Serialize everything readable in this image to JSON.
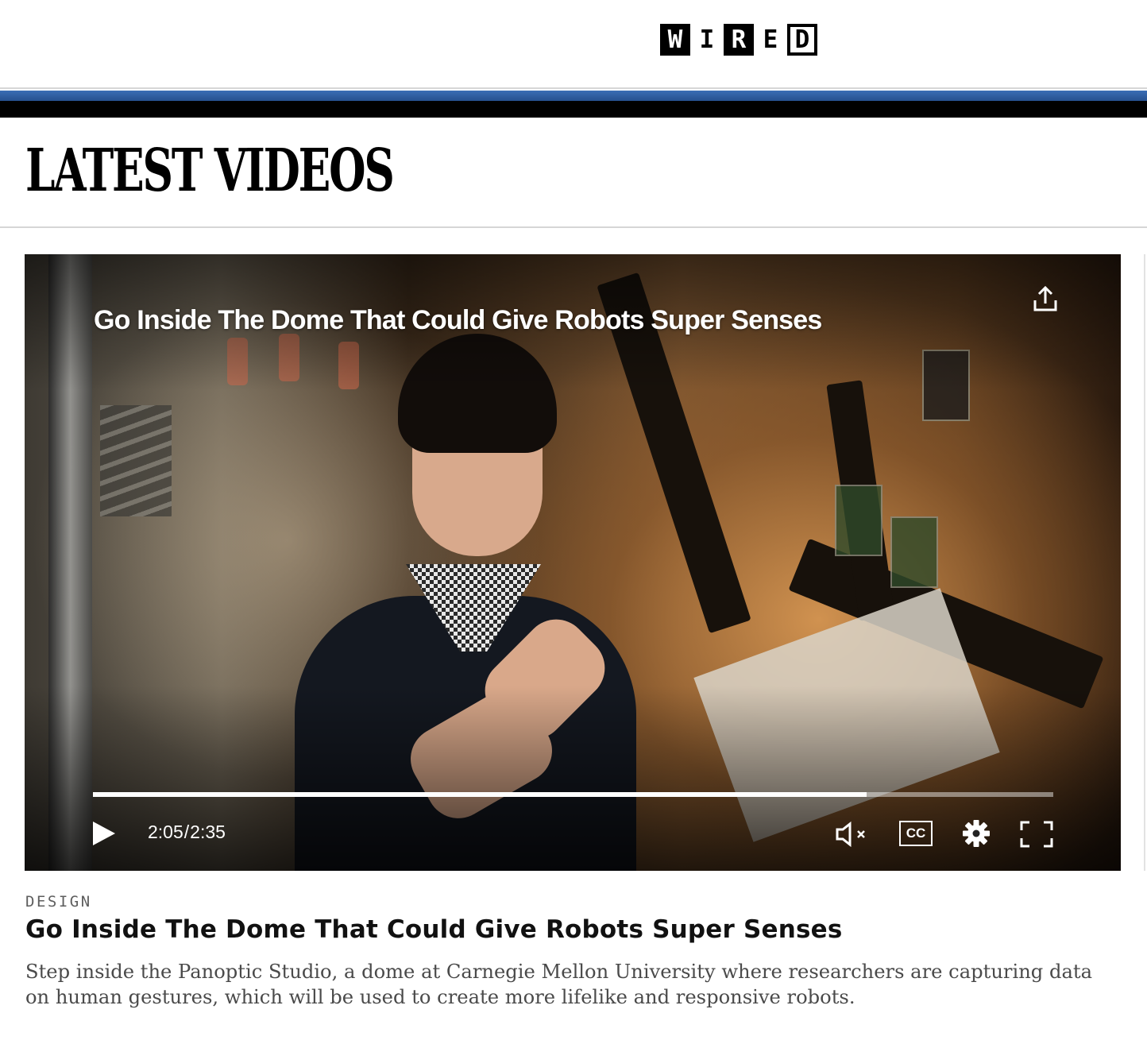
{
  "header": {
    "logo_letters": [
      "W",
      "I",
      "R",
      "E",
      "D"
    ],
    "logo_alt": "WIRED"
  },
  "section": {
    "heading": "LATEST VIDEOS"
  },
  "player": {
    "overlay_title": "Go Inside The Dome That Could Give Robots Super Senses",
    "current_time": "2:05",
    "separator": "/",
    "duration": "2:35",
    "progress_fraction": 0.806,
    "captions_label": "CC",
    "icons": {
      "share": "share-icon",
      "play": "play-icon",
      "mute": "volume-muted-icon",
      "captions": "closed-captions-icon",
      "settings": "gear-icon",
      "fullscreen": "fullscreen-icon"
    }
  },
  "article": {
    "category": "DESIGN",
    "title": "Go Inside The Dome That Could Give Robots Super Senses",
    "description": "Step inside the Panoptic Studio, a dome at Carnegie Mellon University where researchers are capturing data on human gestures, which will be used to create more lifelike and responsive robots."
  },
  "colors": {
    "band_blue": "#3b6eb5",
    "band_black": "#000000",
    "category_gray": "#5e5e5e",
    "description_gray": "#4a4a4a"
  }
}
